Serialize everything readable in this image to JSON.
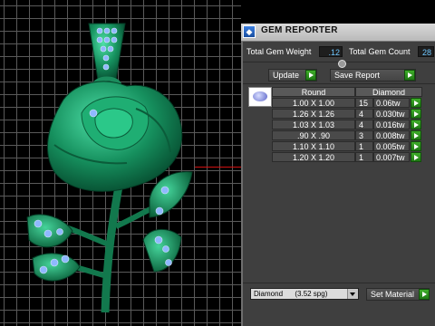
{
  "panel": {
    "title": "GEM REPORTER",
    "total_weight_label": "Total Gem Weight",
    "total_weight_value": ".12",
    "total_count_label": "Total Gem Count",
    "total_count_value": "28",
    "update_label": "Update",
    "save_report_label": "Save Report",
    "table": {
      "headers": [
        "Round",
        "Diamond"
      ],
      "rows": [
        {
          "size": "1.00 X 1.00",
          "count": "15",
          "weight": "0.06tw"
        },
        {
          "size": "1.26 X 1.26",
          "count": "4",
          "weight": "0.030tw"
        },
        {
          "size": "1.03 X 1.03",
          "count": "4",
          "weight": "0.016tw"
        },
        {
          "size": ".90 X .90",
          "count": "3",
          "weight": "0.008tw"
        },
        {
          "size": "1.10 X 1.10",
          "count": "1",
          "weight": "0.005tw"
        },
        {
          "size": "1.20 X 1.20",
          "count": "1",
          "weight": "0.007tw"
        }
      ]
    },
    "material_value": "Diamond      (3.52 spg)",
    "set_material_label": "Set Material"
  },
  "colors": {
    "model": "#1a8a5c",
    "gem": "#7fb4ff",
    "accent_value": "#6fc7ff",
    "button_green": "#2f9a1f"
  }
}
